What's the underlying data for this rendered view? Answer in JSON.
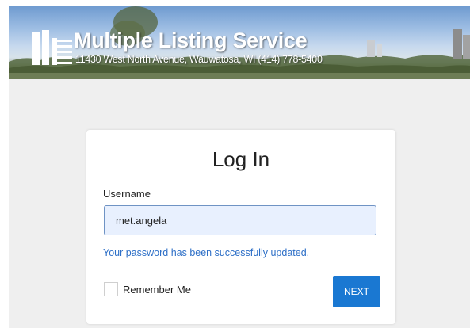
{
  "banner": {
    "title": "Multiple Listing Service",
    "subtitle": "11430 West North Avenue, Wauwatosa, WI  (414) 778-5400",
    "logo_icon": "mls-building-logo-icon"
  },
  "login": {
    "title": "Log In",
    "username_label": "Username",
    "username_value": "met.angela",
    "status_message": "Your password has been successfully updated.",
    "remember_label": "Remember Me",
    "remember_checked": false,
    "next_label": "NEXT"
  },
  "colors": {
    "accent": "#1a78d2",
    "status_text": "#2d6fc7",
    "input_bg": "#e8f0fe",
    "page_bg": "#efefef"
  }
}
